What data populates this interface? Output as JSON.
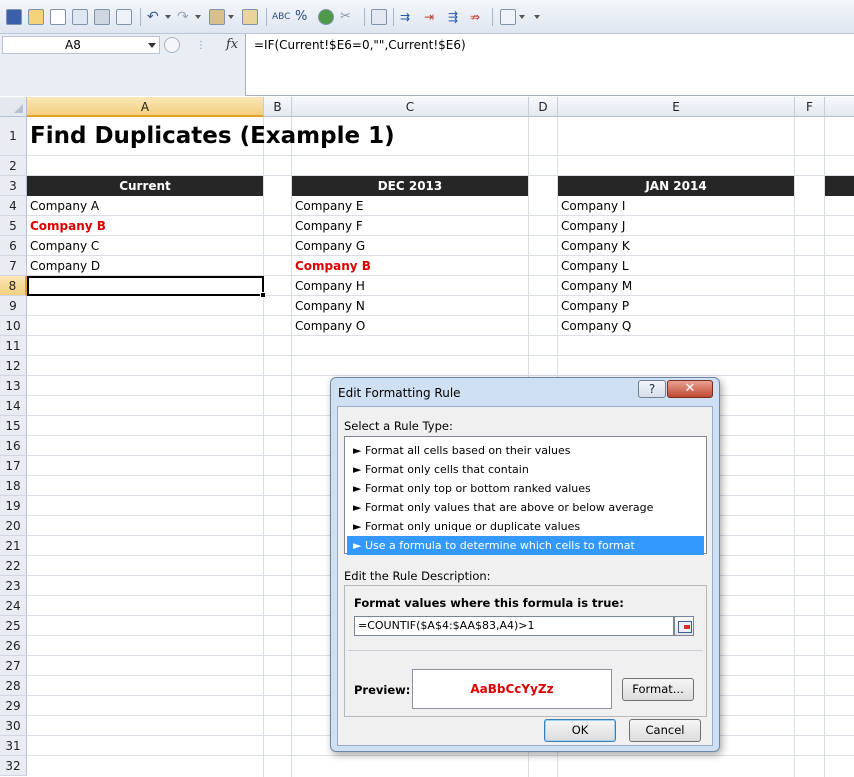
{
  "toolbar": {
    "icons": [
      "save-icon",
      "open-icon",
      "new-icon",
      "print-preview-icon",
      "print-icon",
      "find-icon",
      "undo-icon",
      "redo-icon",
      "paste-icon",
      "copy-icon",
      "spelling-icon",
      "percent-icon",
      "hyperlink-icon",
      "remove-hyperlink-icon",
      "table-icon",
      "trace-precedents-icon",
      "remove-arrows-icon",
      "trace-dependents-icon",
      "show-formulas-icon",
      "customize-icon"
    ]
  },
  "formula_bar": {
    "name_box": "A8",
    "fx_label": "fx",
    "formula": "=IF(Current!$E6=0,\"\",Current!$E6)"
  },
  "grid": {
    "columns": [
      "A",
      "B",
      "C",
      "D",
      "E",
      "F"
    ],
    "active_column": "A",
    "rows": [
      "1",
      "2",
      "3",
      "4",
      "5",
      "6",
      "7",
      "8",
      "9",
      "10",
      "11",
      "12",
      "13",
      "14",
      "15",
      "16",
      "17",
      "18",
      "19",
      "20",
      "21",
      "22",
      "23",
      "24",
      "25",
      "26",
      "27",
      "28",
      "29",
      "30",
      "31",
      "32"
    ],
    "active_row": "8",
    "title": "Find Duplicates (Example 1)",
    "headers": {
      "current": "Current",
      "dec": "DEC 2013",
      "jan": "JAN 2014"
    },
    "col_a": [
      "Company A",
      "Company B",
      "Company C",
      "Company D"
    ],
    "col_c": [
      "Company E",
      "Company F",
      "Company G",
      "Company B",
      "Company H",
      "Company N",
      "Company O"
    ],
    "col_e": [
      "Company I",
      "Company J",
      "Company K",
      "Company L",
      "Company M",
      "Company P",
      "Company Q"
    ],
    "duplicate_color": "#e00000",
    "header_band_color": "#262626"
  },
  "dialog": {
    "title": "Edit Formatting Rule",
    "help_label": "?",
    "close_label": "✕",
    "select_rule_label": "Select a Rule Type:",
    "rule_types": [
      "► Format all cells based on their values",
      "► Format only cells that contain",
      "► Format only top or bottom ranked values",
      "► Format only values that are above or below average",
      "► Format only unique or duplicate values",
      "► Use a formula to determine which cells to format"
    ],
    "selected_rule_index": 5,
    "edit_desc_label": "Edit the Rule Description:",
    "formula_label": "Format values where this formula is true:",
    "formula_value": "=COUNTIF($A$4:$AA$83,A4)>1",
    "preview_label": "Preview:",
    "preview_text": "AaBbCcYyZz",
    "format_button": "Format...",
    "ok_button": "OK",
    "cancel_button": "Cancel",
    "selection_color": "#3399ff"
  }
}
